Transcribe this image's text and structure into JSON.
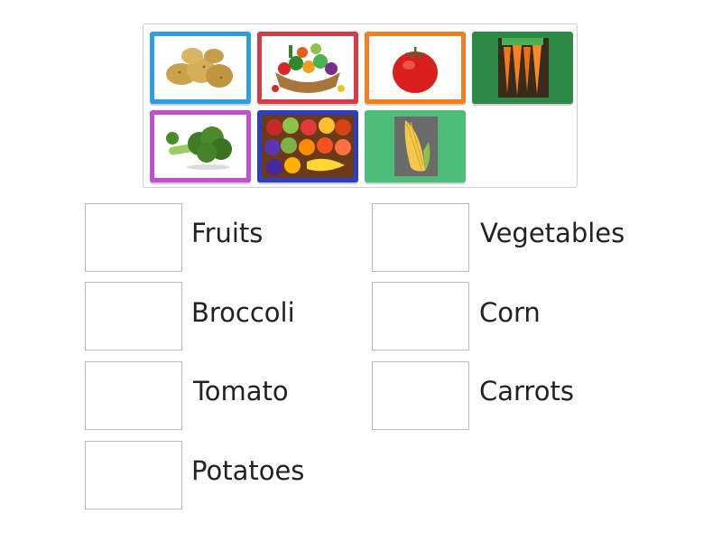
{
  "tiles": [
    {
      "name": "potatoes",
      "icon": "potatoes-image",
      "border": "#2f9ee0"
    },
    {
      "name": "vegetable-basket",
      "icon": "vegetables-basket-image",
      "border": "#d53a45"
    },
    {
      "name": "tomato",
      "icon": "tomato-image",
      "border": "#f07f1c"
    },
    {
      "name": "carrots",
      "icon": "carrots-image",
      "border": "#2e8b47"
    },
    {
      "name": "broccoli",
      "icon": "broccoli-image",
      "border": "#c24fd0"
    },
    {
      "name": "fruits",
      "icon": "fruits-image",
      "border": "#2d3ec4"
    },
    {
      "name": "corn",
      "icon": "corn-image",
      "border": "#4fbd7a"
    }
  ],
  "targets": [
    {
      "label": "Fruits"
    },
    {
      "label": "Vegetables"
    },
    {
      "label": "Broccoli"
    },
    {
      "label": "Corn"
    },
    {
      "label": "Tomato"
    },
    {
      "label": "Carrots"
    },
    {
      "label": "Potatoes"
    }
  ]
}
